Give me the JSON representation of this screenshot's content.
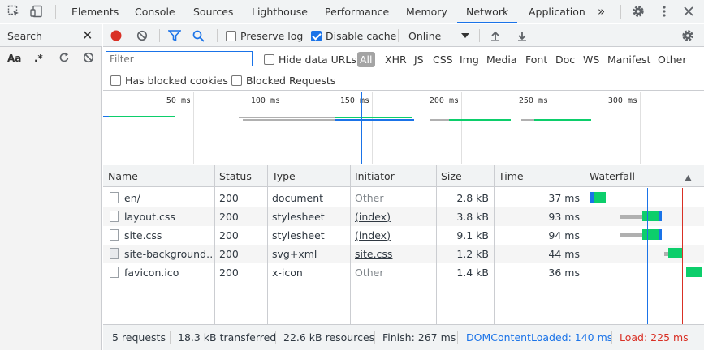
{
  "tabs": [
    "Elements",
    "Console",
    "Sources",
    "Lighthouse",
    "Performance",
    "Memory",
    "Network",
    "Application"
  ],
  "active_tab": "Network",
  "more_tabs": "»",
  "search": {
    "title": "Search",
    "case_label": "Aa",
    "regex_label": ".*"
  },
  "toolbar": {
    "preserve_log": "Preserve log",
    "disable_cache": "Disable cache",
    "throttling": "Online"
  },
  "filter": {
    "placeholder": "Filter",
    "hide_data_urls": "Hide data URLs",
    "types": [
      "All",
      "XHR",
      "JS",
      "CSS",
      "Img",
      "Media",
      "Font",
      "Doc",
      "WS",
      "Manifest",
      "Other"
    ],
    "has_blocked_cookies": "Has blocked cookies",
    "blocked_requests": "Blocked Requests"
  },
  "overview": {
    "ticks": [
      "50 ms",
      "100 ms",
      "150 ms",
      "200 ms",
      "250 ms",
      "300 ms"
    ]
  },
  "columns": {
    "name": "Name",
    "status": "Status",
    "type": "Type",
    "initiator": "Initiator",
    "size": "Size",
    "time": "Time",
    "waterfall": "Waterfall"
  },
  "rows": [
    {
      "name": "en/",
      "status": "200",
      "type": "document",
      "initiator": "Other",
      "size": "2.8 kB",
      "time": "37 ms"
    },
    {
      "name": "layout.css",
      "status": "200",
      "type": "stylesheet",
      "initiator": "(index)",
      "size": "3.8 kB",
      "time": "93 ms"
    },
    {
      "name": "site.css",
      "status": "200",
      "type": "stylesheet",
      "initiator": "(index)",
      "size": "9.1 kB",
      "time": "94 ms"
    },
    {
      "name": "site-background…",
      "status": "200",
      "type": "svg+xml",
      "initiator": "site.css",
      "size": "1.2 kB",
      "time": "44 ms"
    },
    {
      "name": "favicon.ico",
      "status": "200",
      "type": "x-icon",
      "initiator": "Other",
      "size": "1.4 kB",
      "time": "36 ms"
    }
  ],
  "status": {
    "requests": "5 requests",
    "transferred": "18.3 kB transferred",
    "resources": "22.6 kB resources",
    "finish": "Finish: 267 ms",
    "dcl": "DOMContentLoaded: 140 ms",
    "load": "Load: 225 ms"
  },
  "colors": {
    "accent": "#1a73e8",
    "dcl": "#1a73e8",
    "load": "#d93025",
    "receive": "#0cce6b"
  }
}
